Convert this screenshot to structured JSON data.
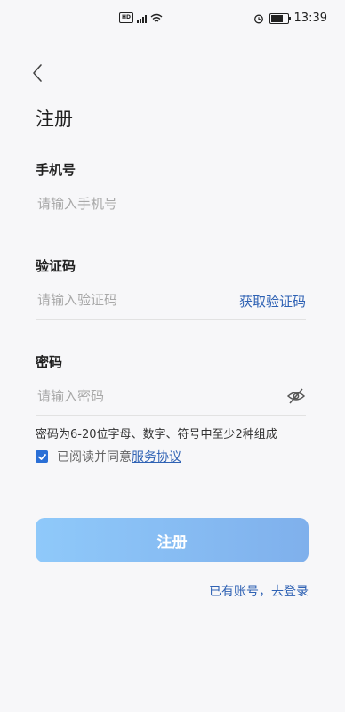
{
  "status_bar": {
    "network": "HD",
    "signal": "4G",
    "time": "13:39",
    "battery_level": 0.85
  },
  "page": {
    "title": "注册"
  },
  "phone": {
    "label": "手机号",
    "placeholder": "请输入手机号"
  },
  "code": {
    "label": "验证码",
    "placeholder": "请输入验证码",
    "get_code": "获取验证码"
  },
  "password": {
    "label": "密码",
    "placeholder": "请输入密码",
    "hint": "密码为6-20位字母、数字、符号中至少2种组成"
  },
  "agreement": {
    "checked": true,
    "text": "已阅读并同意",
    "link": "服务协议"
  },
  "register_button": "注册",
  "login_link": "已有账号，去登录",
  "colors": {
    "accent": "#2f62b4",
    "button_start": "#8fc9fa",
    "button_end": "#7fb0ec",
    "checkbox": "#2a6fd6"
  }
}
